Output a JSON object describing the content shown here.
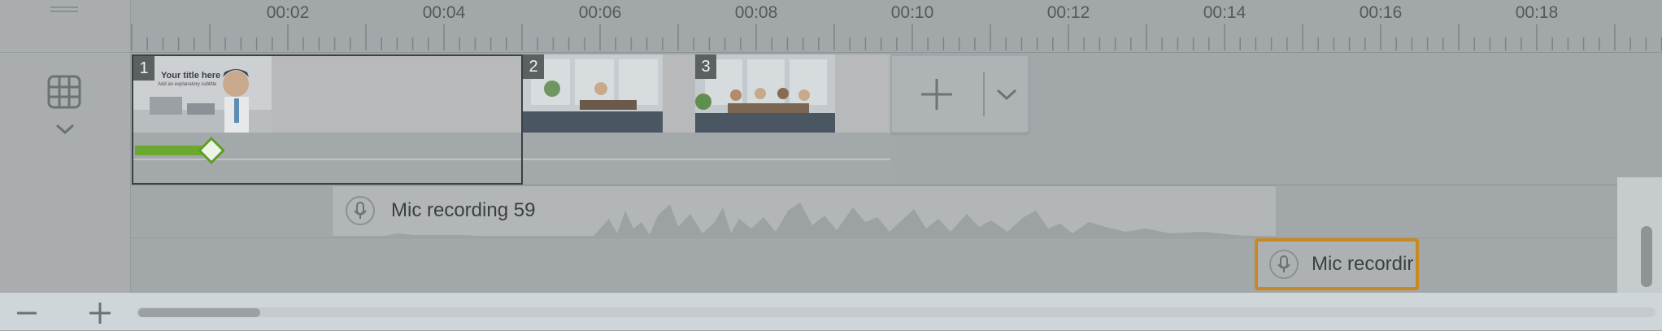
{
  "ruler": {
    "labels": [
      "00:02",
      "00:04",
      "00:06",
      "00:08",
      "00:10",
      "00:12",
      "00:14",
      "00:16",
      "00:18"
    ]
  },
  "scenes": [
    {
      "number": "1",
      "thumb_title": "Your title here",
      "thumb_subtitle": "Add an explanatory subtitle"
    },
    {
      "number": "2"
    },
    {
      "number": "3"
    }
  ],
  "audio": {
    "clip1_label": "Mic recording 59",
    "clip2_label": "Mic recordir"
  },
  "icons": {
    "grid": "grid-icon",
    "chevron": "chevron-down-icon",
    "plus": "plus-icon",
    "mic": "microphone-icon",
    "zoom_out": "minus-icon",
    "zoom_in": "plus-icon"
  },
  "colors": {
    "progress": "#6aa82f",
    "selected_clip_border": "#c78a22"
  },
  "scene1_progress_fraction": 0.2
}
